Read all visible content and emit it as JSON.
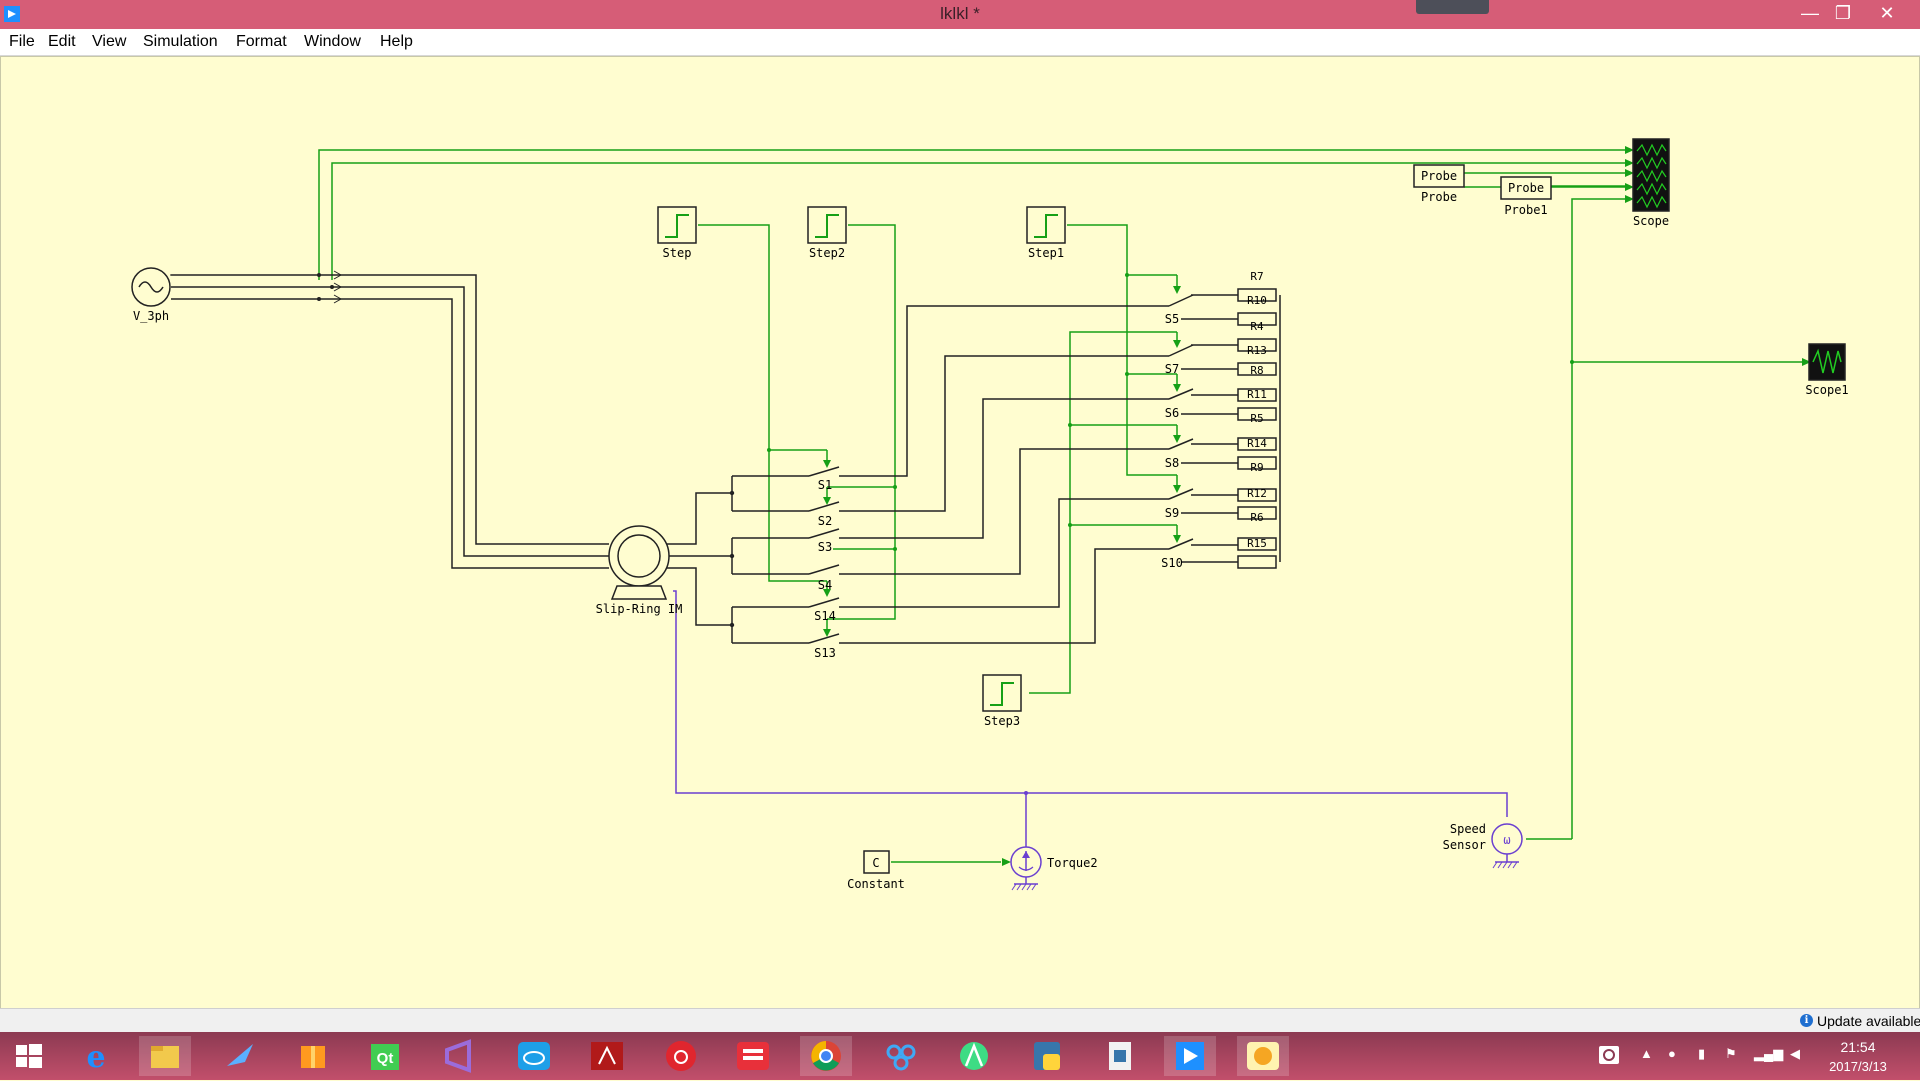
{
  "window": {
    "title": "lklkl *",
    "minimize": "—",
    "maximize": "❐",
    "close": "✕"
  },
  "menu": [
    "File",
    "Edit",
    "View",
    "Simulation",
    "Format",
    "Window",
    "Help"
  ],
  "diagram": {
    "source": "V_3ph",
    "motor": "Slip-Ring IM",
    "steps": [
      "Step",
      "Step2",
      "Step1",
      "Step3"
    ],
    "switches_left": [
      "S1",
      "S2",
      "S3",
      "S4",
      "S14",
      "S13"
    ],
    "switches_right": [
      "S5",
      "S7",
      "S6",
      "S8",
      "S9",
      "S10"
    ],
    "resistors": [
      "R7",
      "R10",
      "R4",
      "R13",
      "R8",
      "R11",
      "R5",
      "R14",
      "R9",
      "R12",
      "R6",
      "R15"
    ],
    "probe_inner": "Probe",
    "probes": [
      "Probe",
      "Probe1"
    ],
    "scopes": [
      "Scope",
      "Scope1"
    ],
    "constant_symbol": "C",
    "constant": "Constant",
    "torque": "Torque2",
    "speed_sensor_line1": "Speed",
    "speed_sensor_line2": "Sensor",
    "speed_sensor_symbol": "ω"
  },
  "status": {
    "update": "Update available",
    "info_symbol": "i"
  },
  "taskbar": {
    "icons": [
      "windows-start-icon",
      "ie-icon",
      "file-explorer-icon",
      "feather-app-icon",
      "package-app-icon",
      "qt-creator-icon",
      "visual-studio-icon",
      "cloud-app-icon",
      "acrobat-icon",
      "netease-music-icon",
      "youdao-icon",
      "chrome-icon",
      "baidu-cloud-icon",
      "android-studio-icon",
      "python-icon",
      "python-file-icon",
      "psim-icon",
      "chat-app-icon"
    ]
  },
  "tray": {
    "time": "21:54",
    "date": "2017/3/13"
  }
}
